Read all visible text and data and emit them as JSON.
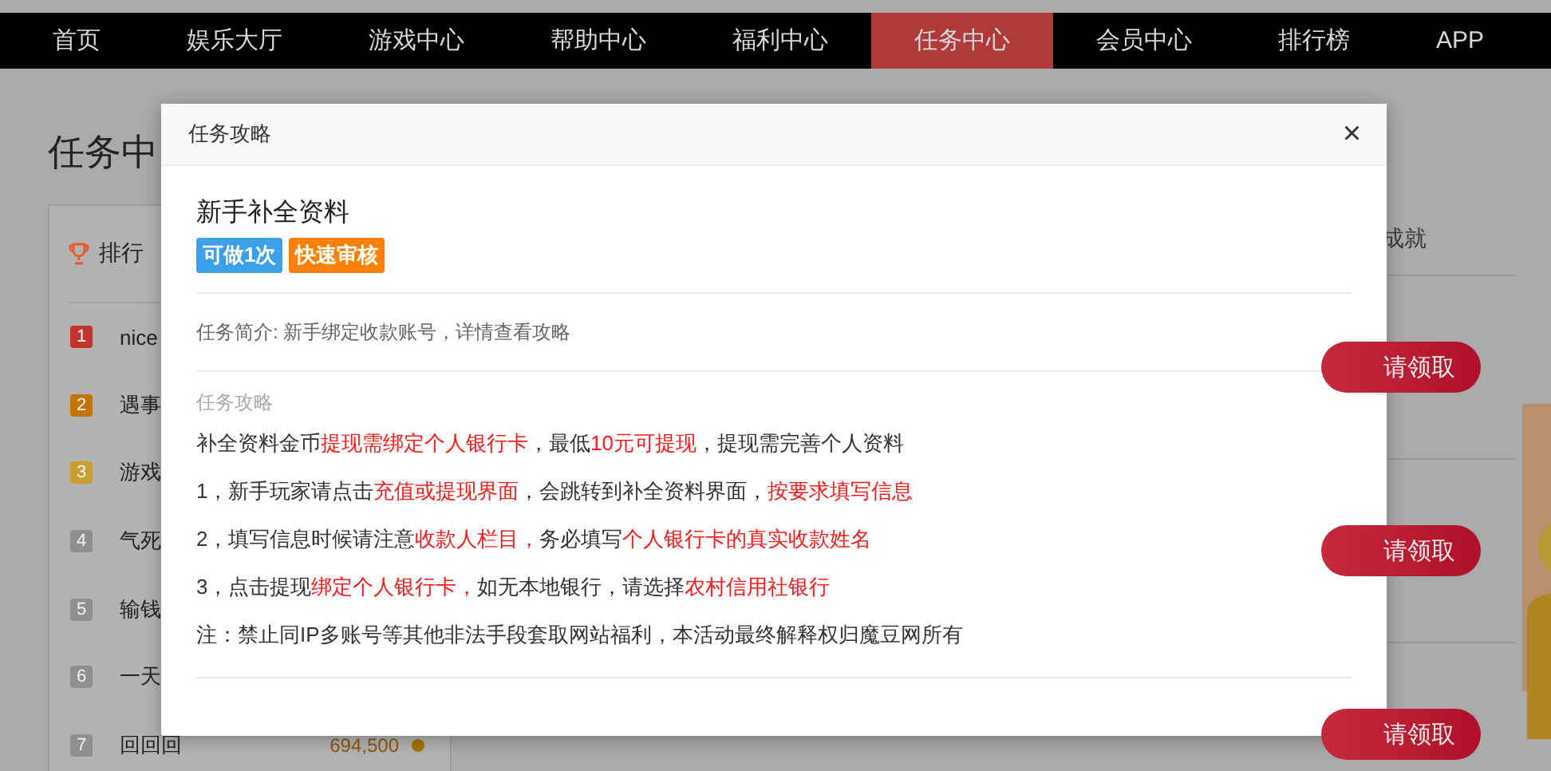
{
  "nav": {
    "items": [
      {
        "label": "首页",
        "selected": false
      },
      {
        "label": "娱乐大厅",
        "selected": false
      },
      {
        "label": "游戏中心",
        "selected": false
      },
      {
        "label": "帮助中心",
        "selected": false
      },
      {
        "label": "福利中心",
        "selected": false
      },
      {
        "label": "任务中心",
        "selected": true
      },
      {
        "label": "会员中心",
        "selected": false
      },
      {
        "label": "排行榜",
        "selected": false
      },
      {
        "label": "APP",
        "selected": false
      }
    ]
  },
  "page": {
    "title": "任务中"
  },
  "leaderboard": {
    "title": "排行",
    "rows": [
      {
        "rank": "1",
        "name": "nice",
        "color": "#c2352e"
      },
      {
        "rank": "2",
        "name": "遇事",
        "color": "#c27406"
      },
      {
        "rank": "3",
        "name": "游戏",
        "color": "#c9a030"
      },
      {
        "rank": "4",
        "name": "气死",
        "color": "#8f8f8f"
      },
      {
        "rank": "5",
        "name": "输钱",
        "color": "#8f8f8f"
      },
      {
        "rank": "6",
        "name": "一天",
        "color": "#8f8f8f"
      },
      {
        "rank": "7",
        "name": "回回回",
        "score": "694,500",
        "color": "#8f8f8f"
      }
    ]
  },
  "tasks": {
    "tab": "成就",
    "rows": [
      {
        "button": "请领取"
      },
      {
        "button": "请领取"
      },
      {
        "button": "请领取"
      }
    ]
  },
  "dialog": {
    "title": "任务攻略",
    "close": "×",
    "task_name": "新手补全资料",
    "badges": [
      {
        "label": "可做1次",
        "kind": "count"
      },
      {
        "label": "快速审核",
        "kind": "fast"
      }
    ],
    "summary": "任务简介: 新手绑定收款账号，详情查看攻略",
    "guide_heading": "任务攻略",
    "guide_lines": [
      [
        {
          "text": "补全资料金币",
          "highlight": false
        },
        {
          "text": "提现需绑定个人银行卡",
          "highlight": true
        },
        {
          "text": "，最低",
          "highlight": false
        },
        {
          "text": "10元可提现",
          "highlight": true
        },
        {
          "text": "，提现需完善个人资料",
          "highlight": false
        }
      ],
      [
        {
          "text": "1，新手玩家请点击",
          "highlight": false
        },
        {
          "text": "充值或提现界面",
          "highlight": true
        },
        {
          "text": "，会跳转到补全资料界面，",
          "highlight": false
        },
        {
          "text": "按要求填写信息",
          "highlight": true
        }
      ],
      [
        {
          "text": "2，填写信息时候请注意",
          "highlight": false
        },
        {
          "text": "收款人栏目，",
          "highlight": true
        },
        {
          "text": "务必填写",
          "highlight": false
        },
        {
          "text": "个人银行卡的真实收款姓名",
          "highlight": true
        }
      ],
      [
        {
          "text": "3，点击提现",
          "highlight": false
        },
        {
          "text": "绑定个人银行卡，",
          "highlight": true
        },
        {
          "text": "如无本地银行，请选择",
          "highlight": false
        },
        {
          "text": "农村信用社银行",
          "highlight": true
        }
      ],
      [
        {
          "text": "注：禁止同IP多账号等其他非法手段套取网站福利，本活动最终解释权归魔豆网所有",
          "highlight": false
        }
      ]
    ]
  }
}
